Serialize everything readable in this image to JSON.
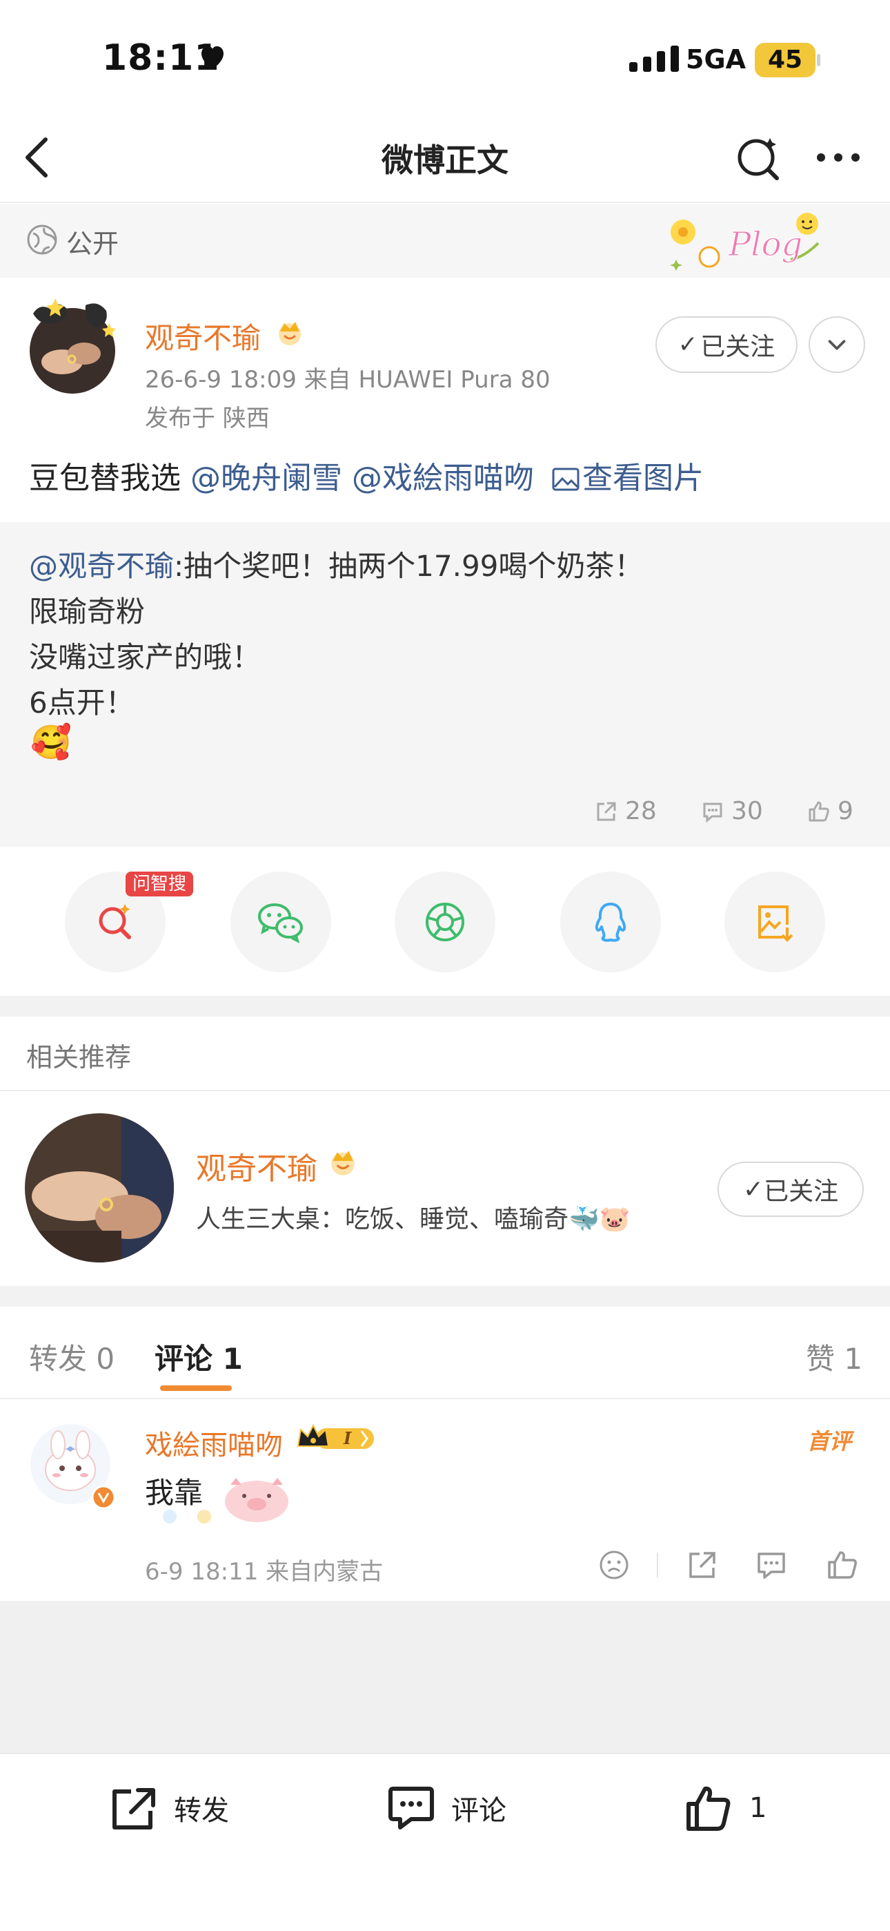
{
  "status_bar": {
    "time": "18:11",
    "network": "5GA",
    "battery": "45"
  },
  "nav": {
    "title": "微博正文"
  },
  "visibility": {
    "label": "公开",
    "sticker_text": "Plog"
  },
  "author": {
    "name": "观奇不瑜",
    "meta": "26-6-9 18:09  来自 HUAWEI Pura 80",
    "location": "发布于 陕西",
    "follow_label": "已关注"
  },
  "post": {
    "prefix": "豆包替我选 ",
    "mention1": "@晚舟阑雪",
    "mention2": " @戏絵雨喵吻",
    "view_image": "查看图片"
  },
  "quoted": {
    "mention": "@观奇不瑜",
    "line1": ":抽个奖吧！抽两个17.99喝个奶茶！",
    "line2": "限瑜奇粉",
    "line3": "没嘴过家产的哦！",
    "line4": "6点开！",
    "emoji": "🥰",
    "reposts": "28",
    "comments": "30",
    "likes": "9"
  },
  "share": {
    "tag": "问智搜"
  },
  "recommend": {
    "title": "相关推荐",
    "name": "观奇不瑜",
    "bio": "人生三大桌：吃饭、睡觉、嗑瑜奇🐳🐷",
    "follow_label": "已关注"
  },
  "tabs": {
    "repost": "转发 0",
    "comment": "评论 1",
    "like": "赞 1"
  },
  "comment": {
    "name": "戏絵雨喵吻",
    "level": "I",
    "first_label": "首评",
    "text": "我靠",
    "meta": "6-9 18:11  来自内蒙古"
  },
  "bottom_bar": {
    "repost": "转发",
    "comment": "评论",
    "like": "1"
  },
  "colors": {
    "accent_orange": "#e8782a",
    "link_blue": "#3d5d8f",
    "badge_red": "#e94545",
    "battery_yellow": "#f2c73a"
  }
}
